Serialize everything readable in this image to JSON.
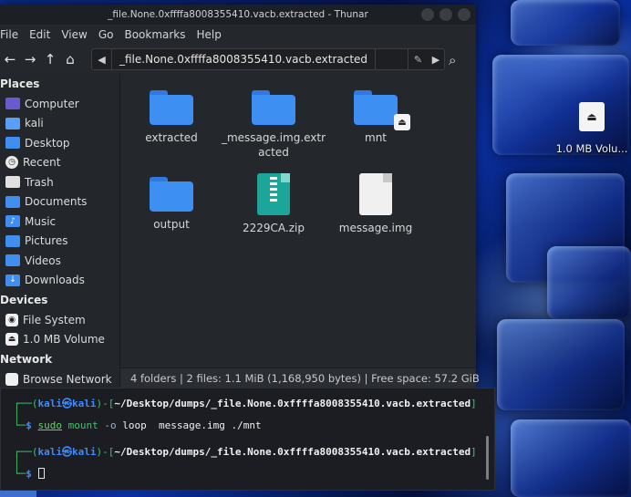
{
  "window": {
    "title": "_file.None.0xffffa8008355410.vacb.extracted - Thunar"
  },
  "menu": [
    "File",
    "Edit",
    "View",
    "Go",
    "Bookmarks",
    "Help"
  ],
  "toolbar": {
    "back_icon": "arrow-left-icon",
    "forward_icon": "arrow-right-icon",
    "up_icon": "arrow-up-icon",
    "home_icon": "home-icon",
    "path_segment": "_file.None.0xffffa8008355410.vacb.extracted",
    "search_icon": "search-icon"
  },
  "sidebar": {
    "places_header": "Places",
    "places": [
      {
        "label": "Computer",
        "icon": "computer-icon"
      },
      {
        "label": "kali",
        "icon": "home-folder-icon"
      },
      {
        "label": "Desktop",
        "icon": "desktop-folder-icon"
      },
      {
        "label": "Recent",
        "icon": "recent-icon"
      },
      {
        "label": "Trash",
        "icon": "trash-icon"
      },
      {
        "label": "Documents",
        "icon": "documents-folder-icon"
      },
      {
        "label": "Music",
        "icon": "music-folder-icon"
      },
      {
        "label": "Pictures",
        "icon": "pictures-folder-icon"
      },
      {
        "label": "Videos",
        "icon": "videos-folder-icon"
      },
      {
        "label": "Downloads",
        "icon": "downloads-folder-icon"
      }
    ],
    "devices_header": "Devices",
    "devices": [
      {
        "label": "File System",
        "icon": "filesystem-icon"
      },
      {
        "label": "1.0 MB Volume",
        "icon": "drive-icon"
      }
    ],
    "network_header": "Network",
    "network": [
      {
        "label": "Browse Network",
        "icon": "network-icon"
      }
    ]
  },
  "files": [
    {
      "name": "extracted",
      "type": "folder"
    },
    {
      "name": "_message.img.extr\nacted",
      "type": "folder"
    },
    {
      "name": "mnt",
      "type": "folder-mounted"
    },
    {
      "name": "output",
      "type": "folder"
    },
    {
      "name": "2229CA.zip",
      "type": "zip"
    },
    {
      "name": "message.img",
      "type": "file"
    }
  ],
  "status": "4 folders  |  2 files: 1.1 MiB (1,168,950 bytes)  |  Free space: 57.2 GiB",
  "desktop": {
    "volume_label": "1.0 MB Volu..."
  },
  "terminal": {
    "prompt_user": "kali",
    "prompt_host": "kali",
    "prompt_path": "~/Desktop/dumps/_file.None.0xffffa8008355410.vacb.extracted",
    "cmd_sudo": "sudo",
    "cmd_rest_1": "mount",
    "cmd_opt": "-o",
    "cmd_rest_2": "loop",
    "cmd_arg1": "message.img",
    "cmd_arg2": "./mnt"
  },
  "colors": {
    "accent_blue": "#3d8ff2",
    "terminal_blue": "#3d8bff",
    "terminal_green": "#3fc56b"
  }
}
